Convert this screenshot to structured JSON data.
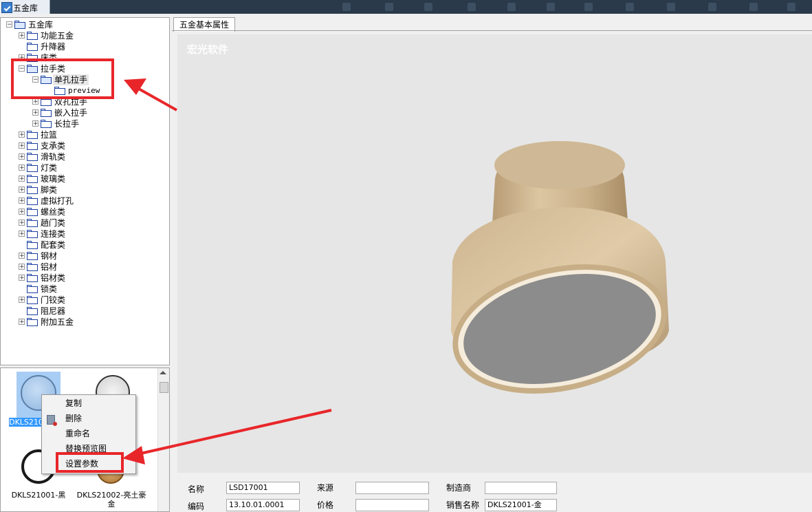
{
  "app": {
    "title": "五金库"
  },
  "tree": {
    "root": "五金库",
    "items": [
      {
        "label": "功能五金",
        "level": 1,
        "expander": "+"
      },
      {
        "label": "升降器",
        "level": 1,
        "expander": ""
      },
      {
        "label": "床类",
        "level": 1,
        "expander": "+"
      },
      {
        "label": "拉手类",
        "level": 1,
        "expander": "-"
      },
      {
        "label": "单孔拉手",
        "level": 2,
        "expander": "-",
        "selected": true
      },
      {
        "label": "preview",
        "level": 3,
        "expander": ""
      },
      {
        "label": "双孔拉手",
        "level": 2,
        "expander": "+"
      },
      {
        "label": "嵌入拉手",
        "level": 2,
        "expander": "+"
      },
      {
        "label": "长拉手",
        "level": 2,
        "expander": "+"
      },
      {
        "label": "拉篮",
        "level": 1,
        "expander": "+"
      },
      {
        "label": "支承类",
        "level": 1,
        "expander": "+"
      },
      {
        "label": "滑轨类",
        "level": 1,
        "expander": "+"
      },
      {
        "label": "灯类",
        "level": 1,
        "expander": "+"
      },
      {
        "label": "玻璃类",
        "level": 1,
        "expander": "+"
      },
      {
        "label": "脚类",
        "level": 1,
        "expander": "+"
      },
      {
        "label": "虚拟打孔",
        "level": 1,
        "expander": "+"
      },
      {
        "label": "螺丝类",
        "level": 1,
        "expander": "+"
      },
      {
        "label": "趟门类",
        "level": 1,
        "expander": "+"
      },
      {
        "label": "连接类",
        "level": 1,
        "expander": "+"
      },
      {
        "label": "配套类",
        "level": 1,
        "expander": ""
      },
      {
        "label": "钢材",
        "level": 1,
        "expander": "+"
      },
      {
        "label": "铝材",
        "level": 1,
        "expander": "+"
      },
      {
        "label": "铝材类",
        "level": 1,
        "expander": "+"
      },
      {
        "label": "锁类",
        "level": 1,
        "expander": ""
      },
      {
        "label": "门铰类",
        "level": 1,
        "expander": "+"
      },
      {
        "label": "阻尼器",
        "level": 1,
        "expander": ""
      },
      {
        "label": "附加五金",
        "level": 1,
        "expander": "+"
      }
    ]
  },
  "thumbnails": [
    {
      "label": "DKLS210",
      "selected": true
    },
    {
      "label": ""
    },
    {
      "label": "DKLS21001-黑"
    },
    {
      "label": "DKLS21002-亮土豪金"
    }
  ],
  "context_menu": {
    "items": [
      "复制",
      "删除",
      "重命名",
      "替换预览图",
      "设置参数"
    ]
  },
  "tabs": [
    "五金基本属性"
  ],
  "preview": {
    "watermark": "宏光软件"
  },
  "properties": {
    "name_label": "名称",
    "name_value": "LSD17001",
    "source_label": "来源",
    "source_value": "",
    "maker_label": "制造商",
    "maker_value": "",
    "code_label": "编码",
    "code_value": "13.10.01.0001",
    "price_label": "价格",
    "price_value": "",
    "sales_name_label": "销售名称",
    "sales_name_value": "DKLS21001-金"
  },
  "colors": {
    "annotation": "#e8262a",
    "selection": "#3399ff",
    "folder": "#1a3fa0"
  }
}
